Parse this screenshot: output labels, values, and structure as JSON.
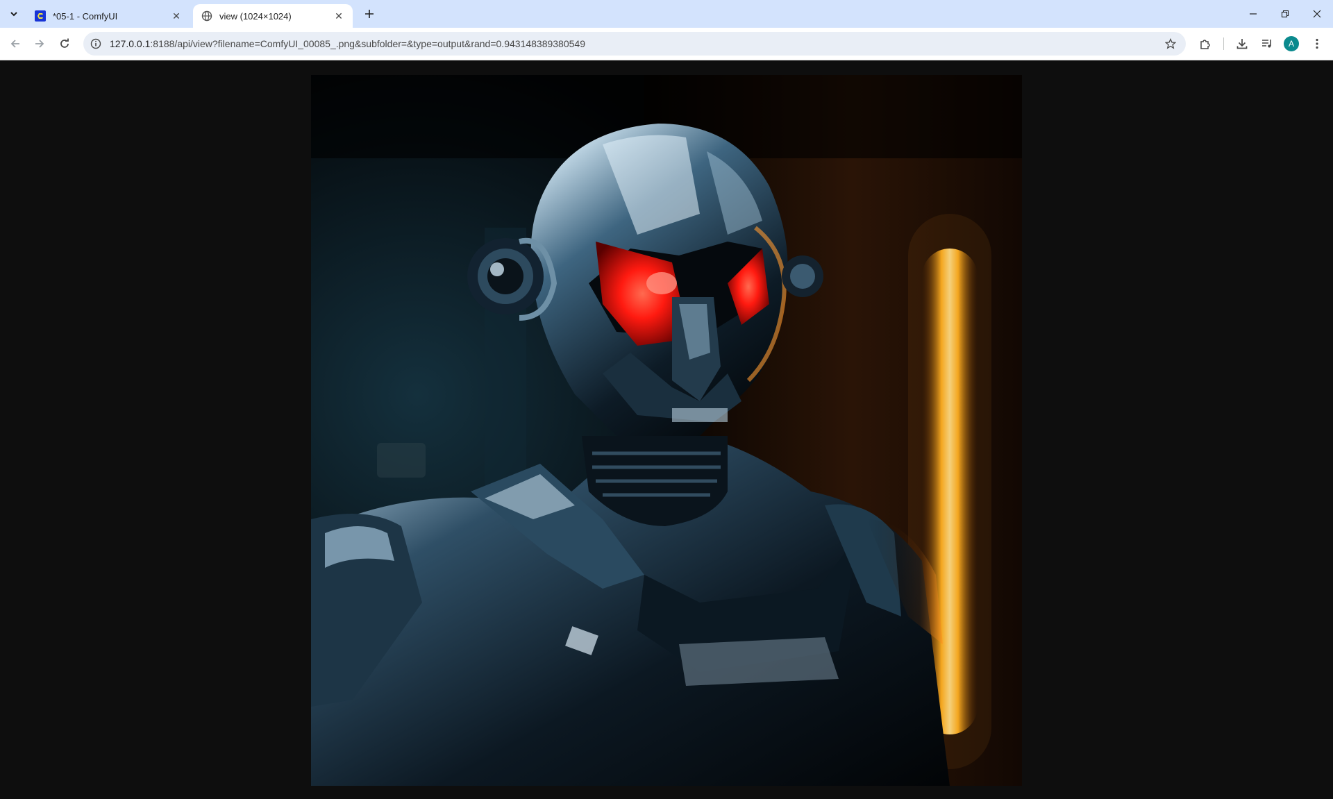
{
  "browser": {
    "tabs": [
      {
        "title": "*05-1 - ComfyUI",
        "favicon": "comfyui-logo-icon",
        "active": false
      },
      {
        "title": "view (1024×1024)",
        "favicon": "globe-icon",
        "active": true
      }
    ],
    "address": {
      "host": "127.0.0.1",
      "path": ":8188/api/view?filename=ComfyUI_00085_.png&subfolder=&type=output&rand=0.943148389380549"
    },
    "profile_initial": "A"
  },
  "viewer": {
    "image_alt": "Robot in dark armor with red eyes",
    "colors": {
      "eyes": "#ff1a10",
      "glow": "#ffb020",
      "armor": "#1a2a3a",
      "background": "#0e0e0e"
    }
  }
}
